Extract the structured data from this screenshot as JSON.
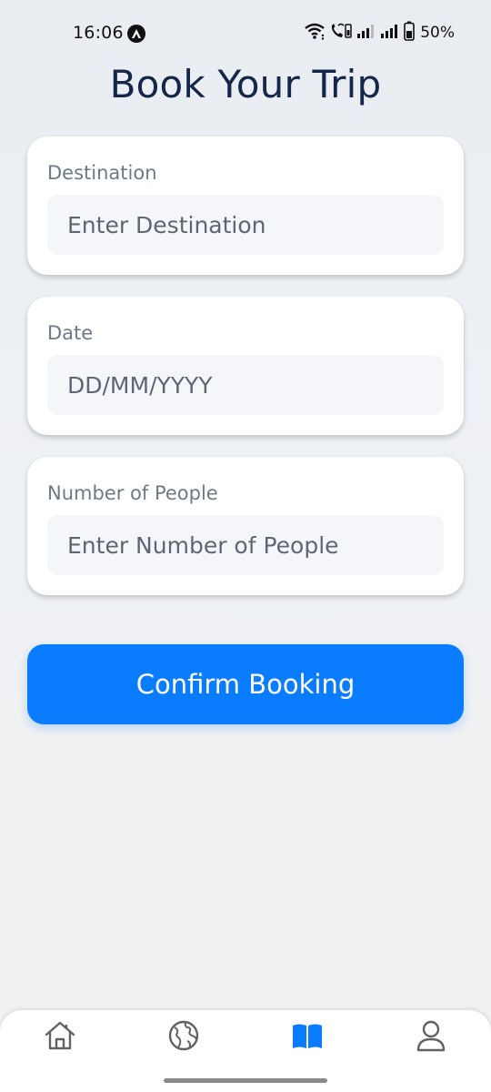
{
  "status_bar": {
    "time": "16:06",
    "battery": "50%"
  },
  "title": "Book Your Trip",
  "form": {
    "destination": {
      "label": "Destination",
      "placeholder": "Enter Destination",
      "value": ""
    },
    "date": {
      "label": "Date",
      "placeholder": "DD/MM/YYYY",
      "value": ""
    },
    "people": {
      "label": "Number of People",
      "placeholder": "Enter Number of People",
      "value": ""
    }
  },
  "confirm_button": {
    "label": "Confirm Booking"
  },
  "bottom_nav": {
    "items": [
      {
        "icon": "home-icon",
        "active": false
      },
      {
        "icon": "globe-icon",
        "active": false
      },
      {
        "icon": "book-icon",
        "active": true
      },
      {
        "icon": "profile-icon",
        "active": false
      }
    ]
  },
  "colors": {
    "accent": "#0a7cff",
    "title": "#14264a",
    "label": "#6b7a8a",
    "inactive_icon": "#5f6368"
  }
}
